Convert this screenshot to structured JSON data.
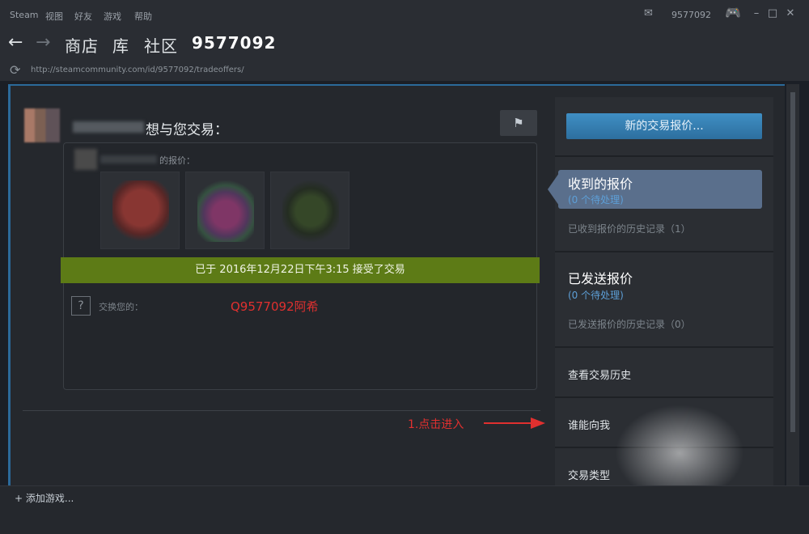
{
  "menubar": {
    "items": [
      "Steam",
      "视图",
      "好友",
      "游戏",
      "帮助"
    ],
    "account": "9577092",
    "icons": {
      "mail": "envelope-icon",
      "controller": "gamepad-icon"
    }
  },
  "nav": {
    "back": "←",
    "forward": "→",
    "links": [
      "商店",
      "库",
      "社区",
      "9577092"
    ]
  },
  "url": "http://steamcommunity.com/id/9577092/tradeoffers/",
  "offer": {
    "wants_text": "想与您交易：",
    "their_offer_label": "的报价：",
    "items": [
      "red-shirt-item",
      "pink-backpack-item",
      "green-star-hoodie-item"
    ],
    "accepted_text": "已于 2016年12月22日下午3:15 接受了交易",
    "exchange_label": "交换您的：",
    "qq_note": "Q9577092阿希"
  },
  "annotation": "1.点击进入",
  "sidebar": {
    "new_offer_button": "新的交易报价...",
    "received": {
      "title": "收到的报价",
      "pending": "(0 个待处理)",
      "history": "已收到报价的历史记录（1）"
    },
    "sent": {
      "title": "已发送报价",
      "pending": "(0 个待处理)",
      "history": "已发送报价的历史记录（0）"
    },
    "view_history": "查看交易历史",
    "who_can_trade": "谁能向我",
    "trade_types": "交易类型"
  },
  "bottom": {
    "add_game": "添加游戏..."
  },
  "colors": {
    "accent_blue": "#3f8fc4",
    "accepted_green": "#5d7b16",
    "annotation_red": "#e0302f"
  }
}
